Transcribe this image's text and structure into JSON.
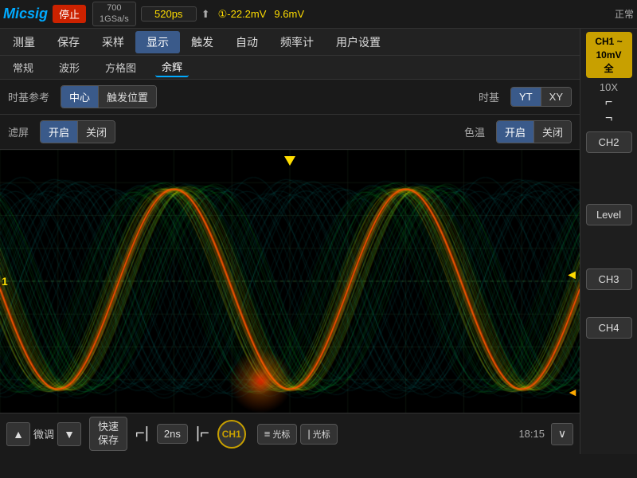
{
  "brand": {
    "logo": "Micsig",
    "stop_label": "停止"
  },
  "top_bar": {
    "sample_rate": "700\n1GSa/s",
    "timebase_value": "520ps",
    "trigger_icon": "⬆",
    "measurement1": "①-22.2mV",
    "measurement2": "9.6mV",
    "status": "正常"
  },
  "menu": {
    "items": [
      "测量",
      "保存",
      "采样",
      "显示",
      "触发",
      "自动",
      "频率计",
      "用户设置"
    ]
  },
  "submenu": {
    "items": [
      "常规",
      "波形",
      "方格图",
      "余辉"
    ]
  },
  "settings_row1": {
    "timebase_ref_label": "时基参考",
    "center_btn": "中心",
    "trigger_pos_btn": "触发位置",
    "timebase_label": "时基",
    "yt_btn": "YT",
    "xy_btn": "XY"
  },
  "settings_row2": {
    "persistence_label": "滤屏",
    "on_btn": "开启",
    "off_btn": "关闭",
    "color_temp_label": "色温",
    "on_btn2": "开启",
    "off_btn2": "关闭"
  },
  "right_panel": {
    "ch1_label": "CH1 ~\n10mV\n全",
    "tx_label": "10X",
    "pulse_up": "⌐",
    "pulse_down": "⌐",
    "ch2_label": "CH2",
    "level_label": "Level",
    "ch3_label": "CH3",
    "ch4_label": "CH4"
  },
  "waveform": {
    "ch1_marker": "1"
  },
  "bottom_bar": {
    "up_arrow": "▲",
    "fine_label": "微调",
    "down_arrow": "▼",
    "quick_save_label": "快速\n保存",
    "pulse_left": "⌐|",
    "time_value": "2ns",
    "pulse_right": "|⌐",
    "ch1_circle": "CH1",
    "cursor1_label": "≡\n光标",
    "cursor2_label": "|\n光标",
    "expand_label": "∨",
    "time_display": "18:15"
  }
}
